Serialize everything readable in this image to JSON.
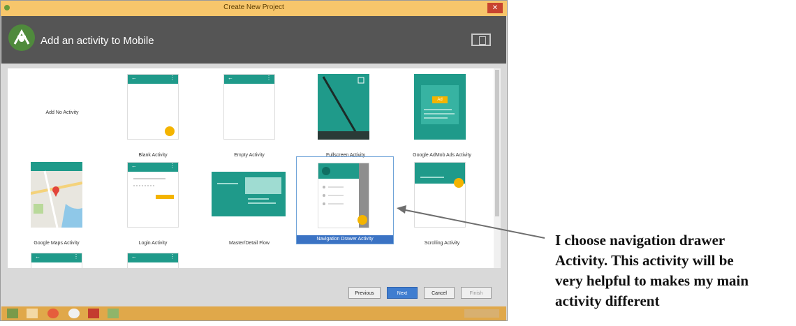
{
  "window": {
    "title": "Create New Project",
    "close_symbol": "✕"
  },
  "header": {
    "title": "Add an activity to Mobile",
    "logo_icon": "android-studio-icon",
    "device_icon": "device-icon"
  },
  "gallery": {
    "items": [
      {
        "label": "Add No Activity"
      },
      {
        "label": "Blank Activity"
      },
      {
        "label": "Empty Activity"
      },
      {
        "label": "Fullscreen Activity"
      },
      {
        "label": "Google AdMob Ads Activity"
      },
      {
        "label": "Google Maps Activity"
      },
      {
        "label": "Login Activity"
      },
      {
        "label": "Master/Detail Flow"
      },
      {
        "label": "Navigation Drawer Activity",
        "selected": true
      },
      {
        "label": "Scrolling Activity"
      }
    ],
    "admob_badge": "Ad"
  },
  "buttons": {
    "previous": "Previous",
    "next": "Next",
    "cancel": "Cancel",
    "finish": "Finish"
  },
  "annotation": {
    "text": "I choose navigation drawer\nActivity. This activity will be\nvery helpful to makes my main\nactivity different"
  },
  "colors": {
    "teal": "#1f9a8a",
    "accent": "#f4b400",
    "selection": "#3b73c4"
  }
}
